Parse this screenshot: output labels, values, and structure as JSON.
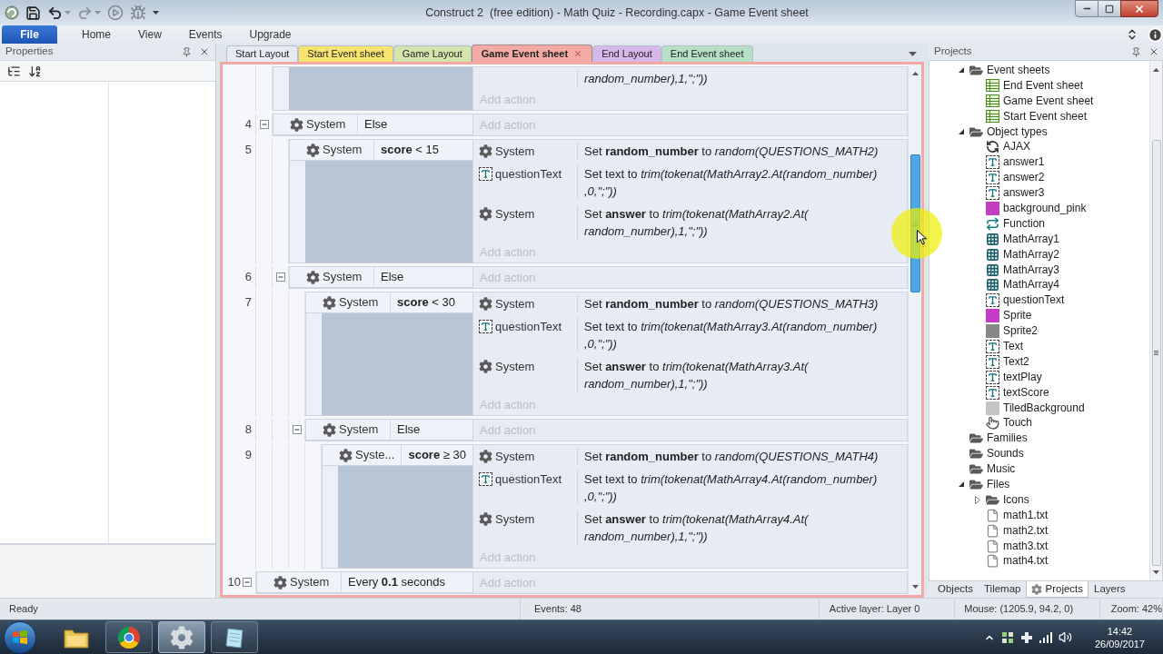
{
  "title_bar": {
    "title": "Construct 2  (free edition) - Math Quiz - Recording.capx - Game Event sheet"
  },
  "ribbon": {
    "tabs": [
      {
        "label": "File",
        "kind": "file"
      },
      {
        "label": "Home",
        "kind": "tab"
      },
      {
        "label": "View",
        "kind": "tab"
      },
      {
        "label": "Events",
        "kind": "tab"
      },
      {
        "label": "Upgrade",
        "kind": "tab"
      }
    ]
  },
  "properties_panel": {
    "title": "Properties"
  },
  "document_tabs": [
    {
      "label": "Start Layout",
      "color": "#e6eaf2",
      "selected": false
    },
    {
      "label": "Start Event sheet",
      "color": "#f7e46f",
      "selected": false
    },
    {
      "label": "Game Layout",
      "color": "#d3e5ad",
      "selected": false
    },
    {
      "label": "Game Event sheet",
      "color": "#f3aaa4",
      "selected": true
    },
    {
      "label": "End Layout",
      "color": "#d8b7ec",
      "selected": false
    },
    {
      "label": "End Event sheet",
      "color": "#b5e0c6",
      "selected": false
    }
  ],
  "event_sheet": {
    "events": [
      {
        "children": [
          {
            "actions": [
              {
                "text": "*random_number),1,\";\"))*"
              }
            ],
            "add_action": "Add action"
          },
          {
            "number": "4",
            "expanded": true,
            "conditions": [
              {
                "kind": "system",
                "object": "System",
                "text": "Else"
              }
            ],
            "add_action": "Add action",
            "children": [
              {
                "number": "5",
                "conditions": [
                  {
                    "kind": "system",
                    "object": "System",
                    "text": "**score** < 15"
                  }
                ],
                "actions": [
                  {
                    "kind": "system",
                    "object": "System",
                    "text": "Set **random_number** to *random(QUESTIONS_MATH2)*"
                  },
                  {
                    "kind": "text",
                    "object": "questionText",
                    "text": "Set text to *trim(tokenat(MathArray2.At(random_number)*\n*,0,\";\"))*"
                  },
                  {
                    "kind": "system",
                    "object": "System",
                    "text": "Set **answer** to *trim(tokenat(MathArray2.At(*\n*random_number),1,\";\"))*"
                  }
                ],
                "add_action": "Add action"
              },
              {
                "number": "6",
                "expanded": true,
                "conditions": [
                  {
                    "kind": "system",
                    "object": "System",
                    "text": "Else"
                  }
                ],
                "add_action": "Add action",
                "children": [
                  {
                    "number": "7",
                    "conditions": [
                      {
                        "kind": "system",
                        "object": "System",
                        "text": "**score** < 30"
                      }
                    ],
                    "actions": [
                      {
                        "kind": "system",
                        "object": "System",
                        "text": "Set **random_number** to *random(QUESTIONS_MATH3)*"
                      },
                      {
                        "kind": "text",
                        "object": "questionText",
                        "text": "Set text to *trim(tokenat(MathArray3.At(random_number)*\n*,0,\";\"))*"
                      },
                      {
                        "kind": "system",
                        "object": "System",
                        "text": "Set **answer** to *trim(tokenat(MathArray3.At(*\n*random_number),1,\";\"))*"
                      }
                    ],
                    "add_action": "Add action"
                  },
                  {
                    "number": "8",
                    "expanded": true,
                    "conditions": [
                      {
                        "kind": "system",
                        "object": "System",
                        "text": "Else"
                      }
                    ],
                    "add_action": "Add action",
                    "children": [
                      {
                        "number": "9",
                        "conditions": [
                          {
                            "kind": "system",
                            "object": "Syste...",
                            "text": "**score** ≥ 30"
                          }
                        ],
                        "actions": [
                          {
                            "kind": "system",
                            "object": "System",
                            "text": "Set **random_number** to *random(QUESTIONS_MATH4)*"
                          },
                          {
                            "kind": "text",
                            "object": "questionText",
                            "text": "Set text to *trim(tokenat(MathArray4.At(random_number)*\n*,0,\";\"))*"
                          },
                          {
                            "kind": "system",
                            "object": "System",
                            "text": "Set **answer** to *trim(tokenat(MathArray4.At(*\n*random_number),1,\";\"))*"
                          }
                        ],
                        "add_action": "Add action"
                      }
                    ]
                  }
                ]
              }
            ]
          }
        ]
      },
      {
        "number": "10",
        "expanded": true,
        "conditions": [
          {
            "kind": "system",
            "object": "System",
            "text": "Every **0.1** seconds"
          }
        ],
        "add_action": "Add action"
      }
    ]
  },
  "projects_panel": {
    "title": "Projects",
    "tree": [
      {
        "label": "Event sheets",
        "kind": "folder",
        "expanded": true,
        "children": [
          {
            "label": "End Event sheet",
            "kind": "event-sheet"
          },
          {
            "label": "Game Event sheet",
            "kind": "event-sheet"
          },
          {
            "label": "Start Event sheet",
            "kind": "event-sheet"
          }
        ]
      },
      {
        "label": "Object types",
        "kind": "folder",
        "expanded": true,
        "children": [
          {
            "label": "AJAX",
            "kind": "ajax"
          },
          {
            "label": "answer1",
            "kind": "text"
          },
          {
            "label": "answer2",
            "kind": "text"
          },
          {
            "label": "answer3",
            "kind": "text"
          },
          {
            "label": "background_pink",
            "kind": "sprite",
            "color": "#c23fc2"
          },
          {
            "label": "Function",
            "kind": "function"
          },
          {
            "label": "MathArray1",
            "kind": "array"
          },
          {
            "label": "MathArray2",
            "kind": "array"
          },
          {
            "label": "MathArray3",
            "kind": "array"
          },
          {
            "label": "MathArray4",
            "kind": "array"
          },
          {
            "label": "questionText",
            "kind": "text"
          },
          {
            "label": "Sprite",
            "kind": "sprite",
            "color": "#c63cc6"
          },
          {
            "label": "Sprite2",
            "kind": "sprite",
            "color": "#888888"
          },
          {
            "label": "Text",
            "kind": "text"
          },
          {
            "label": "Text2",
            "kind": "text"
          },
          {
            "label": "textPlay",
            "kind": "text"
          },
          {
            "label": "textScore",
            "kind": "text"
          },
          {
            "label": "TiledBackground",
            "kind": "sprite",
            "color": "#c4c4c4"
          },
          {
            "label": "Touch",
            "kind": "touch"
          }
        ]
      },
      {
        "label": "Families",
        "kind": "folder"
      },
      {
        "label": "Sounds",
        "kind": "folder"
      },
      {
        "label": "Music",
        "kind": "folder"
      },
      {
        "label": "Files",
        "kind": "folder",
        "expanded": true,
        "children": [
          {
            "label": "Icons",
            "kind": "folder",
            "expanded": false
          },
          {
            "label": "math1.txt",
            "kind": "file"
          },
          {
            "label": "math2.txt",
            "kind": "file"
          },
          {
            "label": "math3.txt",
            "kind": "file"
          },
          {
            "label": "math4.txt",
            "kind": "file"
          }
        ]
      }
    ],
    "tabs": [
      {
        "label": "Objects",
        "selected": false
      },
      {
        "label": "Tilemap",
        "selected": false
      },
      {
        "label": "Projects",
        "selected": true
      },
      {
        "label": "Layers",
        "selected": false
      }
    ]
  },
  "status_bar": [
    "Ready",
    "Events: 48",
    "Active layer: Layer 0",
    "Mouse: (1205.9, 94.2, 0)",
    "Zoom: 42%"
  ],
  "taskbar": {
    "apps": [
      {
        "kind": "folder",
        "running": false,
        "selected": false
      },
      {
        "kind": "browser",
        "running": true,
        "selected": false
      },
      {
        "kind": "construct",
        "running": true,
        "selected": true
      },
      {
        "kind": "notepad",
        "running": true,
        "selected": false
      }
    ],
    "clock": {
      "time": "14:42",
      "date": "26/09/2017"
    }
  }
}
